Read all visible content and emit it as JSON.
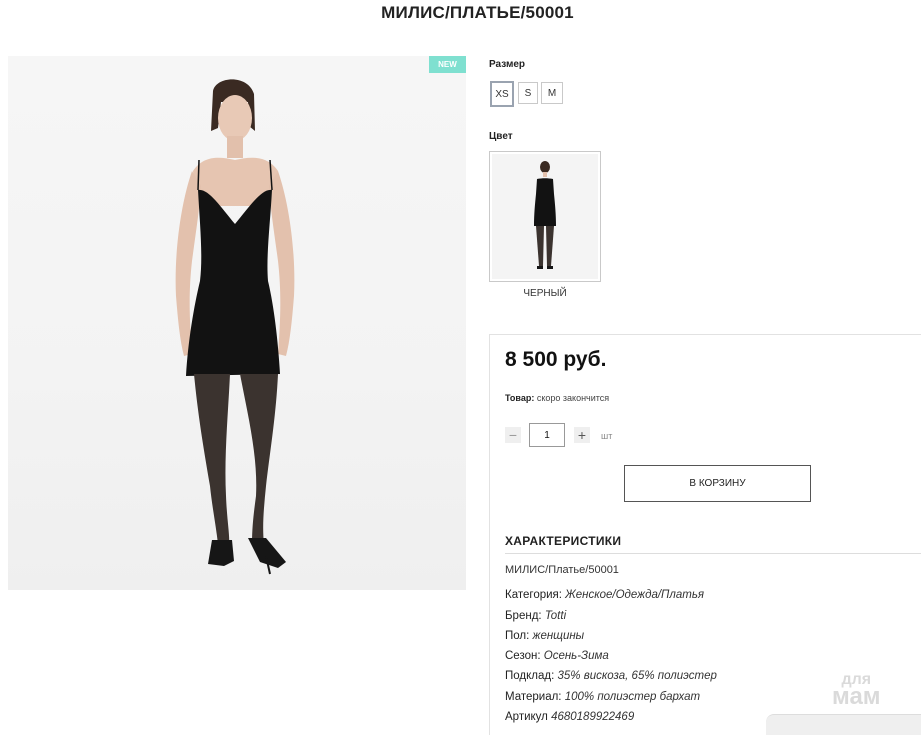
{
  "title": "МИЛИС/ПЛАТЬЕ/50001",
  "badge": "NEW",
  "size_section": {
    "label": "Размер",
    "options": [
      "XS",
      "S",
      "M"
    ],
    "selected": "XS"
  },
  "color_section": {
    "label": "Цвет",
    "swatch_label": "ЧЕРНЫЙ"
  },
  "price": "8 500 руб.",
  "stock": {
    "label": "Товар:",
    "value": "скоро закончится"
  },
  "quantity": {
    "value": "1",
    "unit": "шт",
    "minus": "−",
    "plus": "+"
  },
  "cart_button": "В КОРЗИНУ",
  "specs": {
    "heading": "ХАРАКТЕРИСТИКИ",
    "sku_line": "МИЛИС/Платье/50001",
    "rows": [
      {
        "label": "Категория:",
        "value": "Женское/Одежда/Платья"
      },
      {
        "label": "Бренд:",
        "value": "Totti"
      },
      {
        "label": "Пол:",
        "value": "женщины"
      },
      {
        "label": "Сезон:",
        "value": "Осень-Зима"
      },
      {
        "label": "Подклад:",
        "value": "35% вискоза, 65% полиэстер"
      },
      {
        "label": "Материал:",
        "value": "100% полиэстер бархат"
      },
      {
        "label": "Артикул",
        "value": "4680189922469"
      }
    ]
  },
  "watermark": {
    "top": "для",
    "bottom": "мам"
  },
  "colors": {
    "badge": "#7fe0d0",
    "dress": "#121212"
  }
}
